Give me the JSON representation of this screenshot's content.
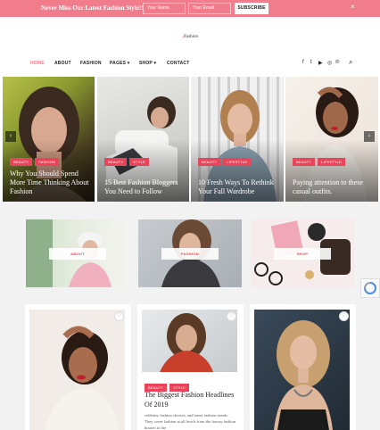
{
  "promo": {
    "text": "Never Miss Our Latest Fashion Style!!",
    "name_placeholder": "Your Name",
    "email_placeholder": "Your Email",
    "button": "SUBSCRIBE",
    "close": "×"
  },
  "header": {
    "logo_mark": "𝒻",
    "logo_text": "Fashion"
  },
  "nav": {
    "items": [
      {
        "label": "HOME"
      },
      {
        "label": "ABOUT"
      },
      {
        "label": "FASHION"
      },
      {
        "label": "PAGES ▾"
      },
      {
        "label": "SHOP ▾"
      },
      {
        "label": "CONTACT"
      }
    ],
    "social": [
      "f",
      "t",
      "▶",
      "◎",
      "℗"
    ],
    "search": "⌕"
  },
  "slider": {
    "prev": "‹",
    "next": "›",
    "slides": [
      {
        "tags": [
          "BEAUTY",
          "FASHION"
        ],
        "title": "Why You Should Spend More Time Thinking About Fashion"
      },
      {
        "tags": [
          "BEAUTY",
          "STYLE"
        ],
        "title": "15 Best Fashion Bloggers You Need to Follow"
      },
      {
        "tags": [
          "BEAUTY",
          "LIFESTYLE"
        ],
        "title": "10 Fresh Ways To Rethink Your Fall Wardrobe"
      },
      {
        "tags": [
          "BEAUTY",
          "LIFESTYLE"
        ],
        "title": "Paying attention to these casual outfits."
      }
    ]
  },
  "categories": [
    {
      "label": "ABOUT"
    },
    {
      "label": "FASHION"
    },
    {
      "label": "SHOP"
    }
  ],
  "posts": [
    {
      "heart": "♡"
    },
    {
      "heart": "♡",
      "tags": [
        "BEAUTY",
        "STYLE"
      ],
      "title": "The Biggest Fashion Headlines Of 2019",
      "excerpt": "celebrity fashion choices, and street fashion trends. They cover fashion at all levels from the luxury fashion houses to the"
    },
    {
      "heart": "♡"
    }
  ],
  "colors": {
    "accent": "#e9445a",
    "promo": "#f07c8c"
  }
}
